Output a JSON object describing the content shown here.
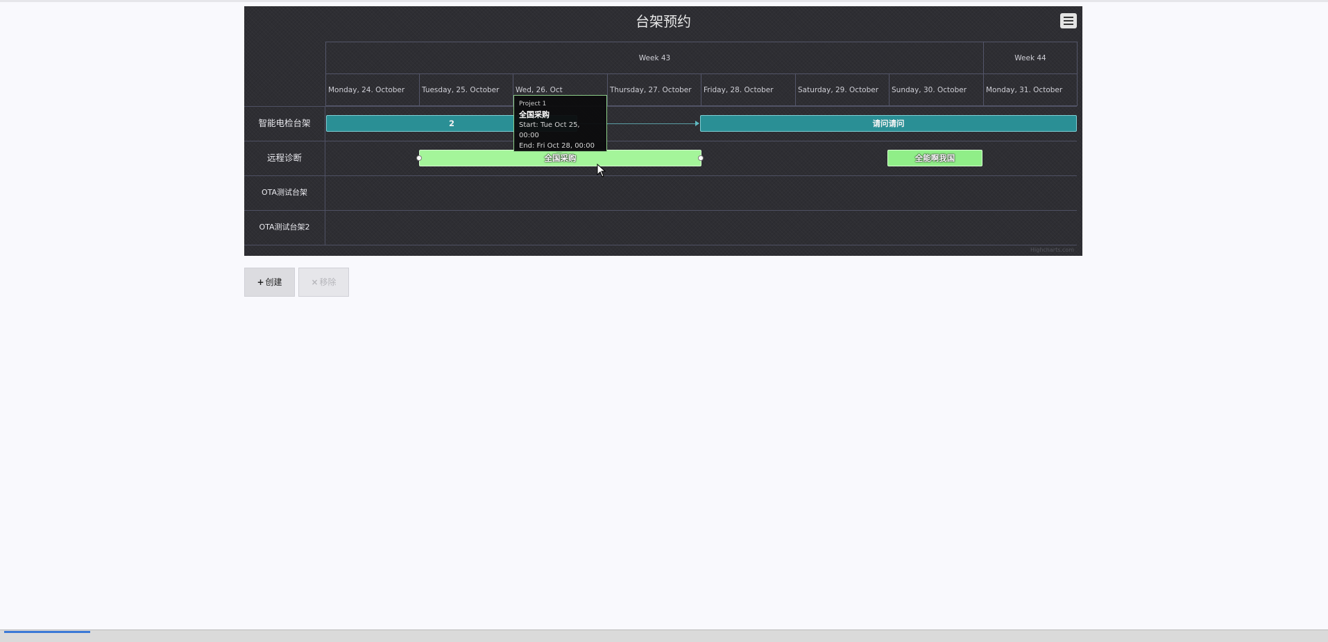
{
  "chart": {
    "title": "台架预约",
    "menu_icon": "hamburger-menu-icon",
    "weeks": [
      {
        "label": "Week 43"
      },
      {
        "label": "Week 44"
      }
    ],
    "days": [
      {
        "label": "Monday, 24. October"
      },
      {
        "label": "Tuesday, 25. October"
      },
      {
        "label": "Wed, 26. Oct"
      },
      {
        "label": "Thursday, 27. October"
      },
      {
        "label": "Friday, 28. October"
      },
      {
        "label": "Saturday, 29. October"
      },
      {
        "label": "Sunday, 30. October"
      },
      {
        "label": "Monday, 31. October"
      }
    ],
    "rows": [
      {
        "label": "智能电检台架"
      },
      {
        "label": "远程诊断"
      },
      {
        "label": "OTA测试台架"
      },
      {
        "label": "OTA测试台架2"
      }
    ],
    "tasks": [
      {
        "name": "2",
        "row": 0,
        "start": "2022-10-24",
        "end": "2022-10-27",
        "color": "#2a8f95"
      },
      {
        "name": "请问请问",
        "row": 0,
        "start": "2022-10-28",
        "end": "2022-11-01",
        "color": "#2a8f95"
      },
      {
        "name": "全国采购",
        "row": 1,
        "start": "2022-10-25",
        "end": "2022-10-28",
        "color": "#a4f59a"
      },
      {
        "name": "全能啊我国",
        "row": 1,
        "start": "2022-10-30",
        "end": "2022-10-31",
        "color": "#90ee88"
      }
    ],
    "tooltip": {
      "project": "Project 1",
      "name": "全国采购",
      "start": "Start: Tue Oct 25, 00:00",
      "end": "End: Fri Oct 28, 00:00"
    },
    "credits": "Highcharts.com"
  },
  "buttons": {
    "create": {
      "glyph": "+",
      "label": "创建"
    },
    "remove": {
      "glyph": "×",
      "label": "移除"
    }
  }
}
